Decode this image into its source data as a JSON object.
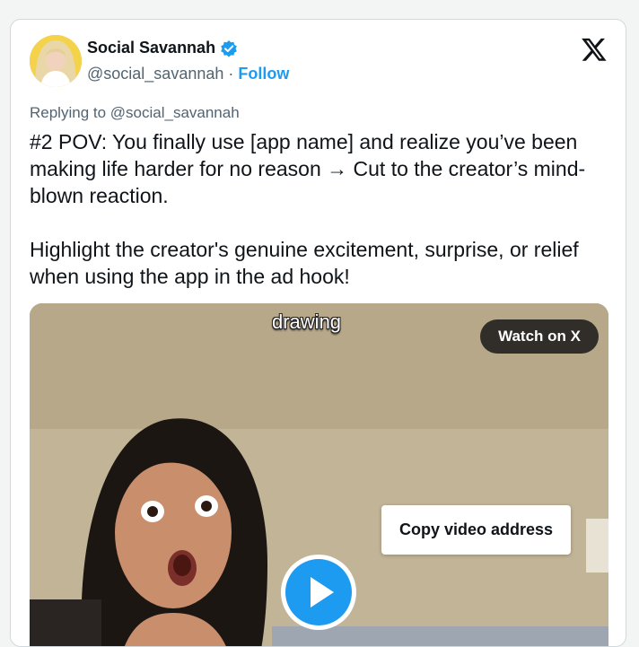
{
  "author": {
    "name": "Social Savannah",
    "handle": "@social_savannah",
    "separator": "·",
    "follow_label": "Follow",
    "verified": true
  },
  "replying_to": "Replying to @social_savannah",
  "tweet": {
    "paragraph1": "#2 POV: You finally use [app name] and realize you’ve been making life harder for no reason → Cut to the creator’s mind-blown reaction.",
    "paragraph2": "Highlight the creator's genuine excitement, surprise, or relief when using the app in the ad hook!"
  },
  "media": {
    "caption": "drawing",
    "watch_label": "Watch on X",
    "context_menu_item": "Copy video address"
  },
  "colors": {
    "accent": "#1d9bf0",
    "text": "#0f1419",
    "secondary_text": "#536471",
    "border": "#cfd9de"
  },
  "icons": {
    "brand": "x-logo-icon",
    "verified": "verified-badge-icon",
    "play": "play-icon"
  }
}
